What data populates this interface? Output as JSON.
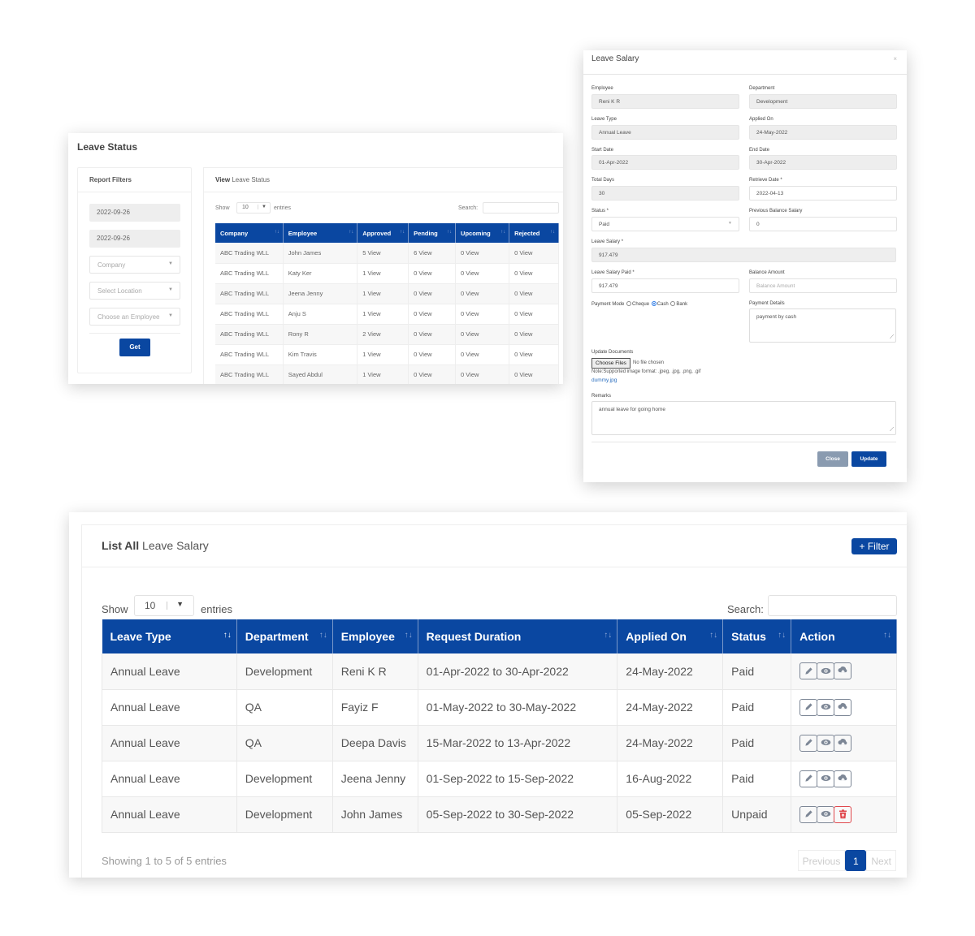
{
  "leave_status": {
    "title": "Leave Status",
    "filters": {
      "heading": "Report Filters",
      "from_date": "2022-09-26",
      "to_date": "2022-09-26",
      "company_placeholder": "Company",
      "location_placeholder": "Select Location",
      "employee_placeholder": "Choose an Employee",
      "get_label": "Get"
    },
    "view": {
      "heading_bold": "View",
      "heading_rest": "Leave Status",
      "show_label": "Show",
      "page_size": "10",
      "entries_label": "entries",
      "search_label": "Search:",
      "columns": [
        "Company",
        "Employee",
        "Approved",
        "Pending",
        "Upcoming",
        "Rejected"
      ],
      "rows": [
        [
          "ABC Trading WLL",
          "John James",
          "5 View",
          "6 View",
          "0 View",
          "0 View"
        ],
        [
          "ABC Trading WLL",
          "Katy Ker",
          "1 View",
          "0 View",
          "0 View",
          "0 View"
        ],
        [
          "ABC Trading WLL",
          "Jeena Jenny",
          "1 View",
          "0 View",
          "0 View",
          "0 View"
        ],
        [
          "ABC Trading WLL",
          "Anju S",
          "1 View",
          "0 View",
          "0 View",
          "0 View"
        ],
        [
          "ABC Trading WLL",
          "Rony R",
          "2 View",
          "0 View",
          "0 View",
          "0 View"
        ],
        [
          "ABC Trading WLL",
          "Kim Travis",
          "1 View",
          "0 View",
          "0 View",
          "0 View"
        ],
        [
          "ABC Trading WLL",
          "Sayed Abdul",
          "1 View",
          "0 View",
          "0 View",
          "0 View"
        ]
      ]
    }
  },
  "modal": {
    "title": "Leave Salary",
    "close_glyph": "×",
    "employee_label": "Employee",
    "employee": "Reni K R",
    "department_label": "Department",
    "department": "Development",
    "leave_type_label": "Leave Type",
    "leave_type": "Annual Leave",
    "applied_on_label": "Applied On",
    "applied_on": "24-May-2022",
    "start_date_label": "Start Date",
    "start_date": "01-Apr-2022",
    "end_date_label": "End Date",
    "end_date": "30-Apr-2022",
    "total_days_label": "Total Days",
    "total_days": "30",
    "retrieve_date_label": "Retrieve Date *",
    "retrieve_date": "2022-04-13",
    "status_label": "Status *",
    "status": "Paid",
    "prev_balance_label": "Previous Balance Salary",
    "prev_balance": "0",
    "leave_salary_label": "Leave Salary *",
    "leave_salary": "917.479",
    "leave_salary_paid_label": "Leave Salary Paid *",
    "leave_salary_paid": "917.479",
    "balance_amount_label": "Balance Amount",
    "balance_amount_placeholder": "Balance Amount",
    "payment_mode_label": "Payment Mode",
    "payment_modes": [
      "Cheque",
      "Cash",
      "Bank"
    ],
    "payment_mode_selected": "Cash",
    "payment_details_label": "Payment Details",
    "payment_details": "payment by cash",
    "documents_label": "Update Documents",
    "choose_files_label": "Choose Files",
    "no_file_label": "No file chosen",
    "format_note": "Note:Supported image format: .jpeg, .jpg, .png, .gif",
    "attached_file": "dummy.jpg",
    "remarks_label": "Remarks",
    "remarks": "annual leave for going home",
    "close_label": "Close",
    "update_label": "Update"
  },
  "list": {
    "heading_bold": "List All",
    "heading_rest": "Leave Salary",
    "filter_label": "+ Filter",
    "show_label": "Show",
    "page_size": "10",
    "entries_label": "entries",
    "search_label": "Search:",
    "columns": [
      "Leave Type",
      "Department",
      "Employee",
      "Request Duration",
      "Applied On",
      "Status",
      "Action"
    ],
    "rows": [
      {
        "leave_type": "Annual Leave",
        "department": "Development",
        "employee": "Reni K R",
        "duration": "01-Apr-2022 to 30-Apr-2022",
        "applied_on": "24-May-2022",
        "status": "Paid",
        "third_action": "upload"
      },
      {
        "leave_type": "Annual Leave",
        "department": "QA",
        "employee": "Fayiz F",
        "duration": "01-May-2022 to 30-May-2022",
        "applied_on": "24-May-2022",
        "status": "Paid",
        "third_action": "upload"
      },
      {
        "leave_type": "Annual Leave",
        "department": "QA",
        "employee": "Deepa Davis",
        "duration": "15-Mar-2022 to 13-Apr-2022",
        "applied_on": "24-May-2022",
        "status": "Paid",
        "third_action": "upload"
      },
      {
        "leave_type": "Annual Leave",
        "department": "Development",
        "employee": "Jeena Jenny",
        "duration": "01-Sep-2022 to 15-Sep-2022",
        "applied_on": "16-Aug-2022",
        "status": "Paid",
        "third_action": "upload"
      },
      {
        "leave_type": "Annual Leave",
        "department": "Development",
        "employee": "John James",
        "duration": "05-Sep-2022 to 30-Sep-2022",
        "applied_on": "05-Sep-2022",
        "status": "Unpaid",
        "third_action": "delete"
      }
    ],
    "info": "Showing 1 to 5 of 5 entries",
    "pagination": {
      "previous": "Previous",
      "current": "1",
      "next": "Next"
    }
  },
  "colors": {
    "primary": "#0a47a1",
    "danger": "#e0494e",
    "close_button": "#8a9bb0"
  }
}
